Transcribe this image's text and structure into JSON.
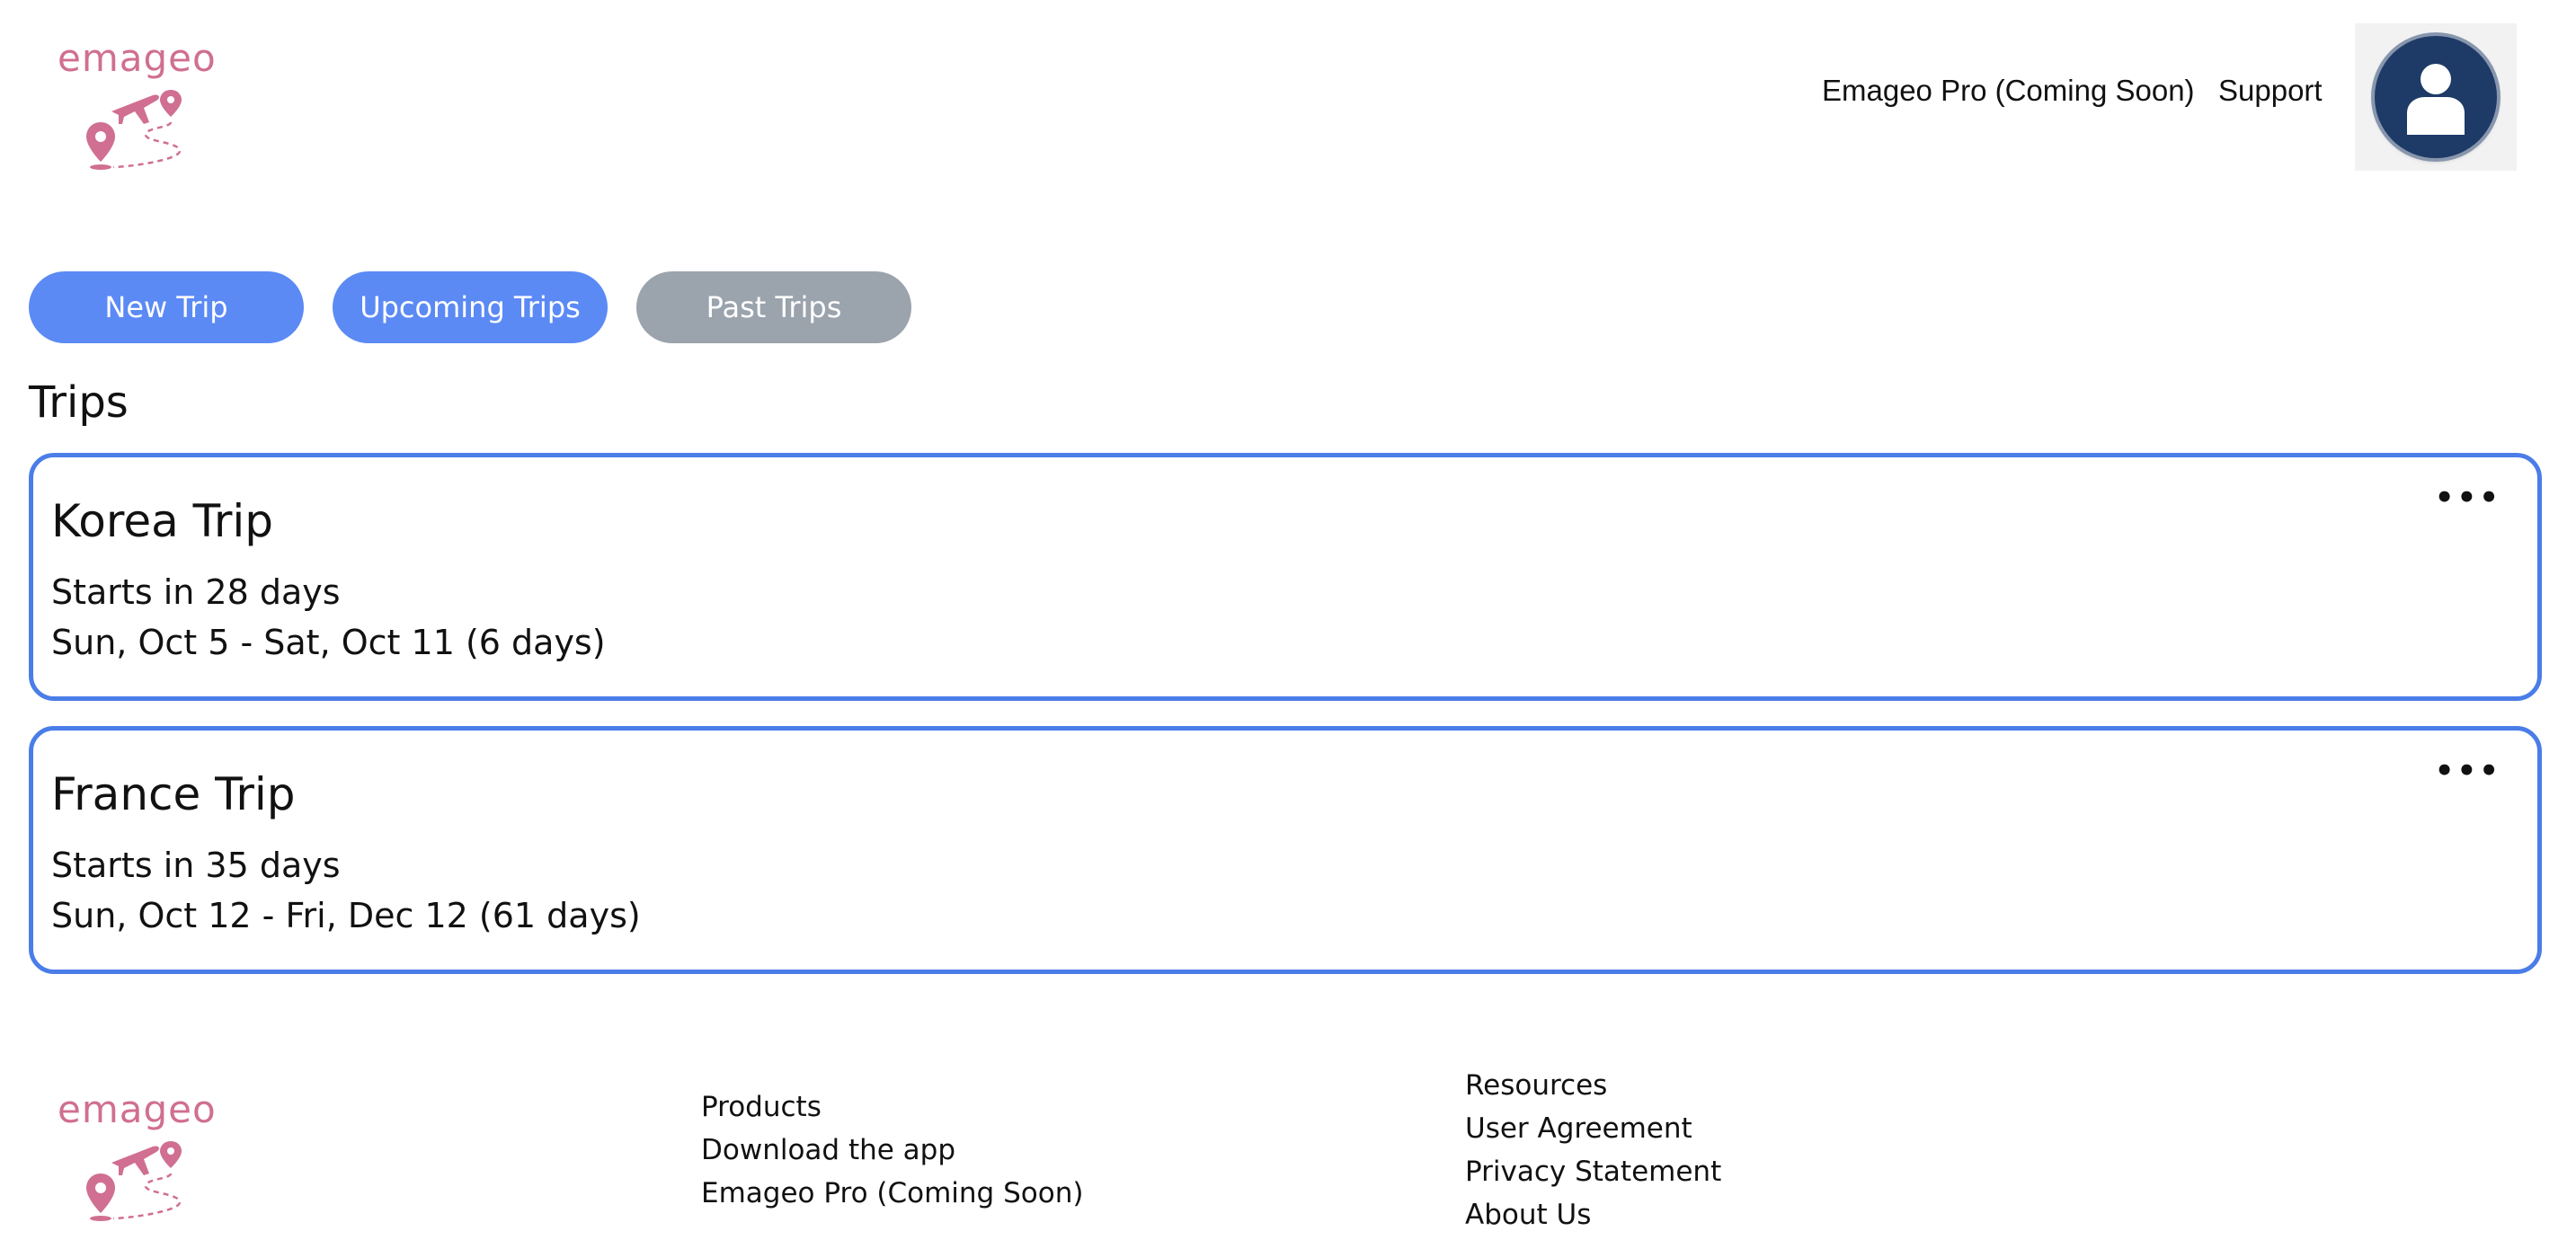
{
  "brand": {
    "logo_text": "emageo",
    "color": "#d06f91"
  },
  "header": {
    "nav": {
      "pro_label": "Emageo Pro (Coming Soon)",
      "support_label": "Support"
    },
    "avatar_icon": "user-avatar-icon"
  },
  "actions": {
    "new_trip": "New Trip",
    "upcoming_trips": "Upcoming Trips",
    "past_trips": "Past Trips"
  },
  "section_title": "Trips",
  "trips": [
    {
      "name": "Korea Trip",
      "starts": "Starts in 28 days",
      "dates": "Sun, Oct 5 - Sat, Oct 11 (6 days)",
      "menu": "•••"
    },
    {
      "name": "France Trip",
      "starts": "Starts in 35 days",
      "dates": "Sun, Oct 12 - Fri, Dec 12 (61 days)",
      "menu": "•••"
    }
  ],
  "footer": {
    "logo_text": "emageo",
    "products": [
      "Products",
      "Download the app",
      "Emageo Pro (Coming Soon)"
    ],
    "resources": [
      "Resources",
      "User Agreement",
      "Privacy Statement",
      "About Us"
    ]
  },
  "colors": {
    "accent": "#5b8af5",
    "card_border": "#4a7de8",
    "inactive": "#9ba3ad",
    "avatar": "#1e3a66"
  }
}
